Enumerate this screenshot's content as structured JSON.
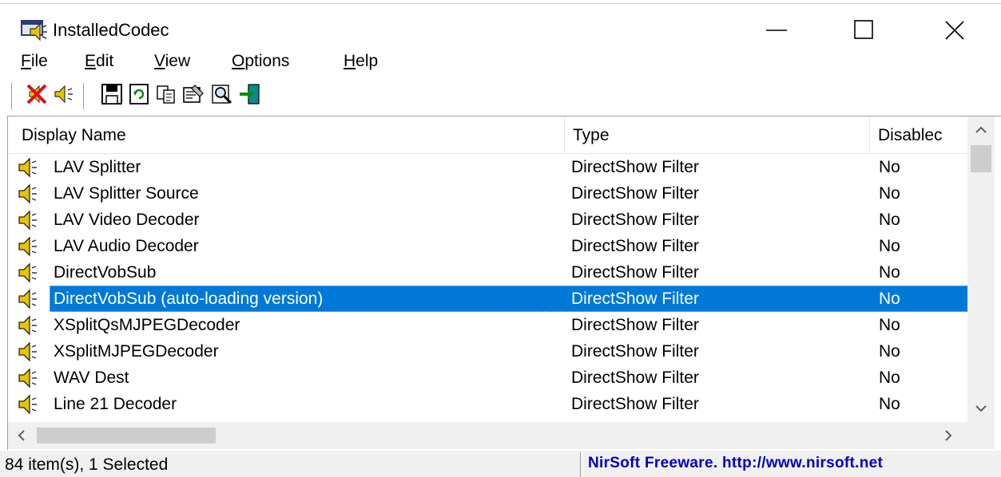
{
  "window": {
    "title": "InstalledCodec",
    "app_icon": "codec-app-icon",
    "controls": {
      "minimize": "minimize-icon",
      "maximize": "maximize-icon",
      "close": "close-icon"
    }
  },
  "menu": [
    {
      "label": "File",
      "accel": "F"
    },
    {
      "label": "Edit",
      "accel": "E"
    },
    {
      "label": "View",
      "accel": "V"
    },
    {
      "label": "Options",
      "accel": "O"
    },
    {
      "label": "Help",
      "accel": "H"
    }
  ],
  "toolbar": {
    "buttons": [
      {
        "icon": "disable-selected-icon"
      },
      {
        "icon": "enable-selected-icon"
      },
      {
        "icon": "save-icon"
      },
      {
        "icon": "refresh-icon"
      },
      {
        "icon": "copy-icon"
      },
      {
        "icon": "properties-icon"
      },
      {
        "icon": "find-icon"
      },
      {
        "icon": "exit-icon"
      }
    ]
  },
  "columns": {
    "name": "Display Name",
    "type": "Type",
    "disabled": "Disablec"
  },
  "rows": [
    {
      "name": "LAV Splitter",
      "type": "DirectShow Filter",
      "disabled": "No",
      "selected": false
    },
    {
      "name": "LAV Splitter Source",
      "type": "DirectShow Filter",
      "disabled": "No",
      "selected": false
    },
    {
      "name": "LAV Video Decoder",
      "type": "DirectShow Filter",
      "disabled": "No",
      "selected": false
    },
    {
      "name": "LAV Audio Decoder",
      "type": "DirectShow Filter",
      "disabled": "No",
      "selected": false
    },
    {
      "name": "DirectVobSub",
      "type": "DirectShow Filter",
      "disabled": "No",
      "selected": false
    },
    {
      "name": "DirectVobSub (auto-loading version)",
      "type": "DirectShow Filter",
      "disabled": "No",
      "selected": true
    },
    {
      "name": "XSplitQsMJPEGDecoder",
      "type": "DirectShow Filter",
      "disabled": "No",
      "selected": false
    },
    {
      "name": "XSplitMJPEGDecoder",
      "type": "DirectShow Filter",
      "disabled": "No",
      "selected": false
    },
    {
      "name": "WAV Dest",
      "type": "DirectShow Filter",
      "disabled": "No",
      "selected": false
    },
    {
      "name": "Line 21 Decoder",
      "type": "DirectShow Filter",
      "disabled": "No",
      "selected": false
    }
  ],
  "status": {
    "left": "84 item(s), 1 Selected",
    "right": "NirSoft Freeware.  http://www.nirsoft.net"
  },
  "colors": {
    "selection": "#0078d7",
    "status_link": "#0000c0",
    "scrollbar_bg": "#f0f0f0"
  }
}
